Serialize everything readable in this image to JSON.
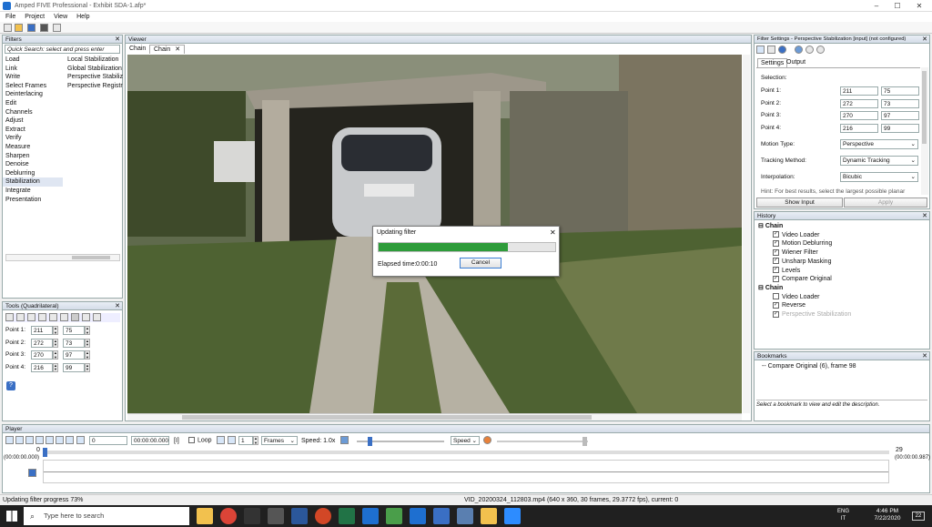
{
  "window": {
    "title": "Amped FIVE Professional - Exhibit SDA-1.afp*",
    "minimize": "–",
    "maximize": "☐",
    "close": "✕"
  },
  "menu": [
    "File",
    "Project",
    "View",
    "Help"
  ],
  "filters": {
    "title": "Filters",
    "search_placeholder": "Quick Search: select and press enter",
    "categories": [
      "Load",
      "Link",
      "Write",
      "Select Frames",
      "Deinterlacing",
      "Edit",
      "Channels",
      "Adjust",
      "Extract",
      "Verify",
      "Measure",
      "Sharpen",
      "Denoise",
      "Deblurring",
      "Stabilization",
      "Integrate",
      "Presentation"
    ],
    "selected_category": "Stabilization",
    "items": [
      "Local Stabilization",
      "Global Stabilization",
      "Perspective Stabilizat",
      "Perspective Registratio"
    ]
  },
  "tools": {
    "title": "Tools (Quadrilateral)",
    "points": [
      {
        "label": "Point 1:",
        "x": "211",
        "y": "75"
      },
      {
        "label": "Point 2:",
        "x": "272",
        "y": "73"
      },
      {
        "label": "Point 3:",
        "x": "270",
        "y": "97"
      },
      {
        "label": "Point 4:",
        "x": "216",
        "y": "99"
      }
    ],
    "help": "?"
  },
  "viewer": {
    "title": "Viewer",
    "tabs": [
      "Chain",
      "Chain"
    ],
    "tab_close": "✕"
  },
  "dialog": {
    "title": "Updating filter",
    "progress": 0.73,
    "elapsed_label": "Elapsed time:",
    "elapsed_value": "0:00:10",
    "cancel": "Cancel",
    "close": "✕"
  },
  "filter_settings": {
    "title": "Filter Settings - Perspective Stabilization [input] (not configured)",
    "tabs": [
      "Settings",
      "Output"
    ],
    "selection_label": "Selection:",
    "points": [
      {
        "label": "Point 1:",
        "x": "211",
        "y": "75"
      },
      {
        "label": "Point 2:",
        "x": "272",
        "y": "73"
      },
      {
        "label": "Point 3:",
        "x": "270",
        "y": "97"
      },
      {
        "label": "Point 4:",
        "x": "216",
        "y": "99"
      }
    ],
    "motion_type_label": "Motion Type:",
    "motion_type": "Perspective",
    "tracking_label": "Tracking Method:",
    "tracking": "Dynamic Tracking",
    "interp_label": "Interpolation:",
    "interp": "Bicubic",
    "hint": "Hint: For best results, select the largest possible planar",
    "show_input": "Show Input",
    "apply": "Apply"
  },
  "history": {
    "title": "History",
    "chain1": "Chain",
    "items1": [
      {
        "name": "Video Loader",
        "checked": true
      },
      {
        "name": "Motion Deblurring",
        "checked": true
      },
      {
        "name": "Wiener Filter",
        "checked": true
      },
      {
        "name": "Unsharp Masking",
        "checked": true
      },
      {
        "name": "Levels",
        "checked": true
      },
      {
        "name": "Compare Original",
        "checked": true
      }
    ],
    "chain2": "Chain",
    "items2": [
      {
        "name": "Video Loader",
        "checked": false
      },
      {
        "name": "Reverse",
        "checked": true
      },
      {
        "name": "Perspective Stabilization",
        "checked": true,
        "dim": true
      }
    ]
  },
  "bookmarks": {
    "title": "Bookmarks",
    "item": "Compare Original (6), frame 98",
    "hint": "Select a bookmark to view and edit the description."
  },
  "player": {
    "title": "Player",
    "frame": "0",
    "time": "00:00:00.000",
    "bracket": "[I]",
    "loop": "Loop",
    "step": "1",
    "unit": "Frames",
    "speed_label": "Speed: 1.0x",
    "speed_mode": "Speed",
    "start_frame": "0",
    "end_frame": "29",
    "start_time": "(00:00:00.000)",
    "end_time": "(00:00:00.987)"
  },
  "status": {
    "left": "Updating filter progress 73%",
    "center": "VID_20200324_112803.mp4 (640 x 360, 30 frames, 29.3772 fps), current: 0"
  },
  "taskbar": {
    "search_placeholder": "Type here to search",
    "time": "4:46 PM",
    "date": "7/22/2020",
    "lang": "ENG",
    "region": "IT",
    "notif": "22"
  }
}
